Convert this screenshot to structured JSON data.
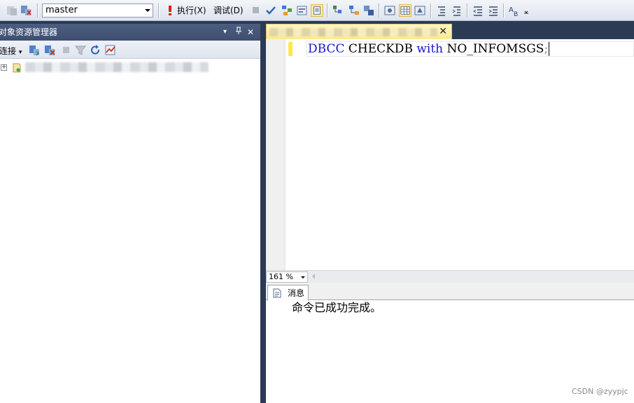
{
  "toolbar": {
    "database": "master",
    "execute_label": "执行(X)",
    "debug_label": "调试(D)"
  },
  "explorer": {
    "title": "对象资源管理器",
    "connect_label": "连接",
    "pin_glyph": "Ҩ",
    "dropdown_glyph": "▾",
    "close_glyph": "✕"
  },
  "tree": {
    "expander": "⊞"
  },
  "editor": {
    "code": {
      "kw1": "DBCC",
      "ident": "CHECKDB",
      "kw2": "with",
      "opt": "NO_INFOMSGS",
      "punct": ";"
    },
    "zoom": "161 %"
  },
  "doc_tab": {
    "close_glyph": "✕"
  },
  "results": {
    "tab_label": "消息",
    "message": "命令已成功完成。"
  },
  "watermark": "CSDN @zyypjc",
  "colors": {
    "keyword": "#1515c8",
    "tab_active": "#ffe98d",
    "title_bar": "#3e4f70"
  }
}
